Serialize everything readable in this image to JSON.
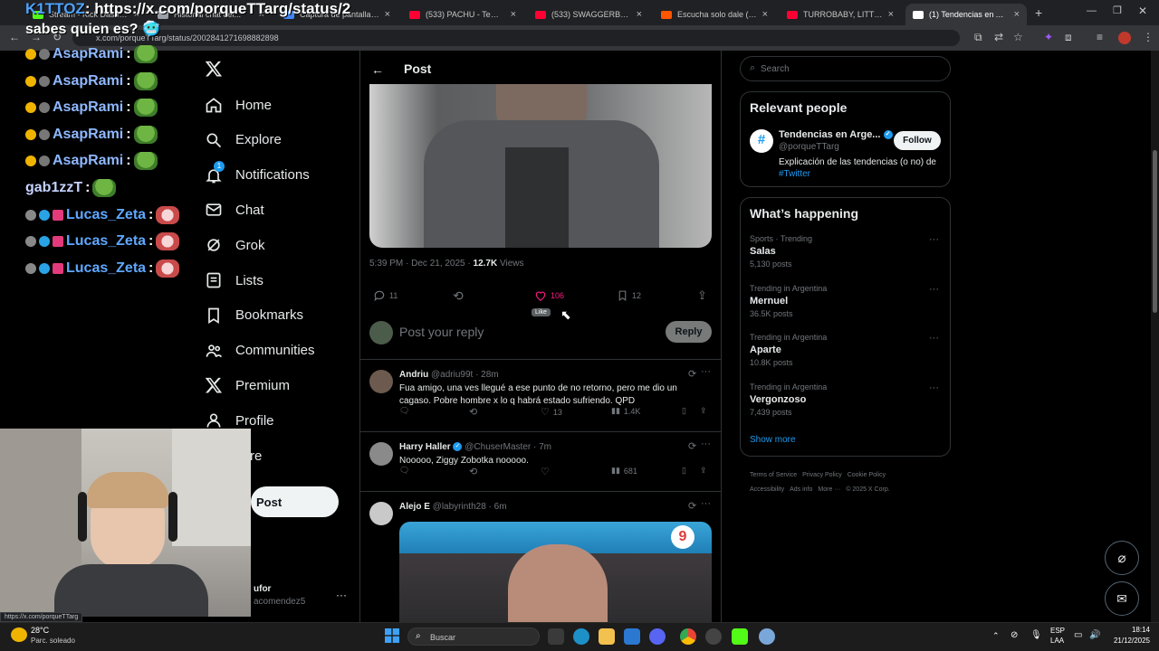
{
  "browser": {
    "tabs": [
      {
        "label": "Stream - Kick Dashboard",
        "favicon": "#53fc18",
        "active": false
      },
      {
        "label": "Historial chat del...",
        "favicon": "#9aa0a6",
        "active": false
      },
      {
        "label": "Captura de pantalla por l...",
        "favicon": "#4285f4",
        "active": false
      },
      {
        "label": "(533) PACHU - Tema - You...",
        "favicon": "#ff0033",
        "active": false
      },
      {
        "label": "(533) SWAGGERBOYZ ft T...",
        "favicon": "#ff0033",
        "active": false
      },
      {
        "label": "Escucha solo dale (prod...",
        "favicon": "#ff5500",
        "active": false
      },
      {
        "label": "TURROBABY, LITTLE BOO...",
        "favicon": "#ff0033",
        "active": false
      },
      {
        "label": "(1) Tendencias en Argent...",
        "favicon": "#ffffff",
        "active": true
      }
    ],
    "url": "x.com/porqueTTarg/status/2002841271698882898"
  },
  "stream_overlay": {
    "top_message_user": "K1TTOZ",
    "top_message_text": ": https://x.com/porqueTTarg/status/2",
    "top_message_line2": "sabes quien es? 🥶",
    "chat": [
      {
        "user": "AsapRami",
        "sep": ":"
      },
      {
        "user": "AsapRami",
        "sep": ":"
      },
      {
        "user": "AsapRami",
        "sep": ":"
      },
      {
        "user": "AsapRami",
        "sep": ":"
      },
      {
        "user": "AsapRami",
        "sep": ":"
      },
      {
        "user": "gab1zzT",
        "sep": ":"
      },
      {
        "user": "Lucas_Zeta",
        "sep": ":"
      },
      {
        "user": "Lucas_Zeta",
        "sep": ":"
      },
      {
        "user": "Lucas_Zeta",
        "sep": ":"
      }
    ]
  },
  "nav": {
    "items": [
      {
        "label": "Home",
        "icon": "home-icon"
      },
      {
        "label": "Explore",
        "icon": "search-icon"
      },
      {
        "label": "Notifications",
        "icon": "bell-icon",
        "badge": "1"
      },
      {
        "label": "Chat",
        "icon": "mail-icon"
      },
      {
        "label": "Grok",
        "icon": "grok-icon"
      },
      {
        "label": "Lists",
        "icon": "list-icon"
      },
      {
        "label": "Bookmarks",
        "icon": "bookmark-icon"
      },
      {
        "label": "Communities",
        "icon": "people-icon"
      },
      {
        "label": "Premium",
        "icon": "x-logo-icon"
      },
      {
        "label": "Profile",
        "icon": "person-icon"
      },
      {
        "label": "re",
        "icon": "more-icon"
      }
    ],
    "post_button": "Post",
    "account_name": "ufor",
    "account_handle": "acomendez5"
  },
  "post": {
    "header_title": "Post",
    "timestamp": "5:39 PM · Dec 21, 2025 · ",
    "views_count": "12.7K",
    "views_label": " Views",
    "replies": "11",
    "likes": "106",
    "bookmarks": "12",
    "like_tooltip": "Like",
    "reply_placeholder": "Post your reply",
    "reply_button": "Reply"
  },
  "replies": [
    {
      "name": "Andriu",
      "handle": "@adriu99t · 28m",
      "verified": false,
      "text": "Fua amigo, una ves llegué a ese punto de no retorno, pero me dio un cagaso. Pobre hombre x lo q habrá estado sufriendo. QPD",
      "likes": "13",
      "views": "1.4K"
    },
    {
      "name": "Harry Haller",
      "handle": "@ChuserMaster · 7m",
      "verified": true,
      "text": "Nooooo, Ziggy Zobotka nooooo.",
      "likes": "",
      "views": "681"
    },
    {
      "name": "Alejo E",
      "handle": "@labyrinth28 · 6m",
      "verified": false,
      "text": "",
      "likes": "",
      "views": ""
    }
  ],
  "right": {
    "search_placeholder": "Search",
    "relevant_title": "Relevant people",
    "person_name": "Tendencias en Arge...",
    "person_handle": "@porqueTTarg",
    "follow": "Follow",
    "bio": "Explicación de las tendencias (o no) de",
    "bio_tag": "#Twitter",
    "happening_title": "What’s happening",
    "trends": [
      {
        "meta": "Sports · Trending",
        "name": "Salas",
        "count": "5,130 posts"
      },
      {
        "meta": "Trending in Argentina",
        "name": "Mernuel",
        "count": "36.5K posts"
      },
      {
        "meta": "Trending in Argentina",
        "name": "Aparte",
        "count": "10.8K posts"
      },
      {
        "meta": "Trending in Argentina",
        "name": "Vergonzoso",
        "count": "7,439 posts"
      }
    ],
    "show_more": "Show more",
    "footer": [
      "Terms of Service",
      "Privacy Policy",
      "Cookie Policy",
      "Accessibility",
      "Ads info",
      "More ···",
      "© 2025 X Corp."
    ]
  },
  "taskbar": {
    "weather_temp": "28°C",
    "weather_desc": "Parc. soleado",
    "search_placeholder": "Buscar",
    "lang_1": "ESP",
    "lang_2": "LAA",
    "time": "18:14",
    "date": "21/12/2025",
    "status_url": "https://x.com/porqueTTarg"
  },
  "colors": {
    "accent": "#1d9bf0",
    "like": "#f91880",
    "bg": "#000000"
  }
}
